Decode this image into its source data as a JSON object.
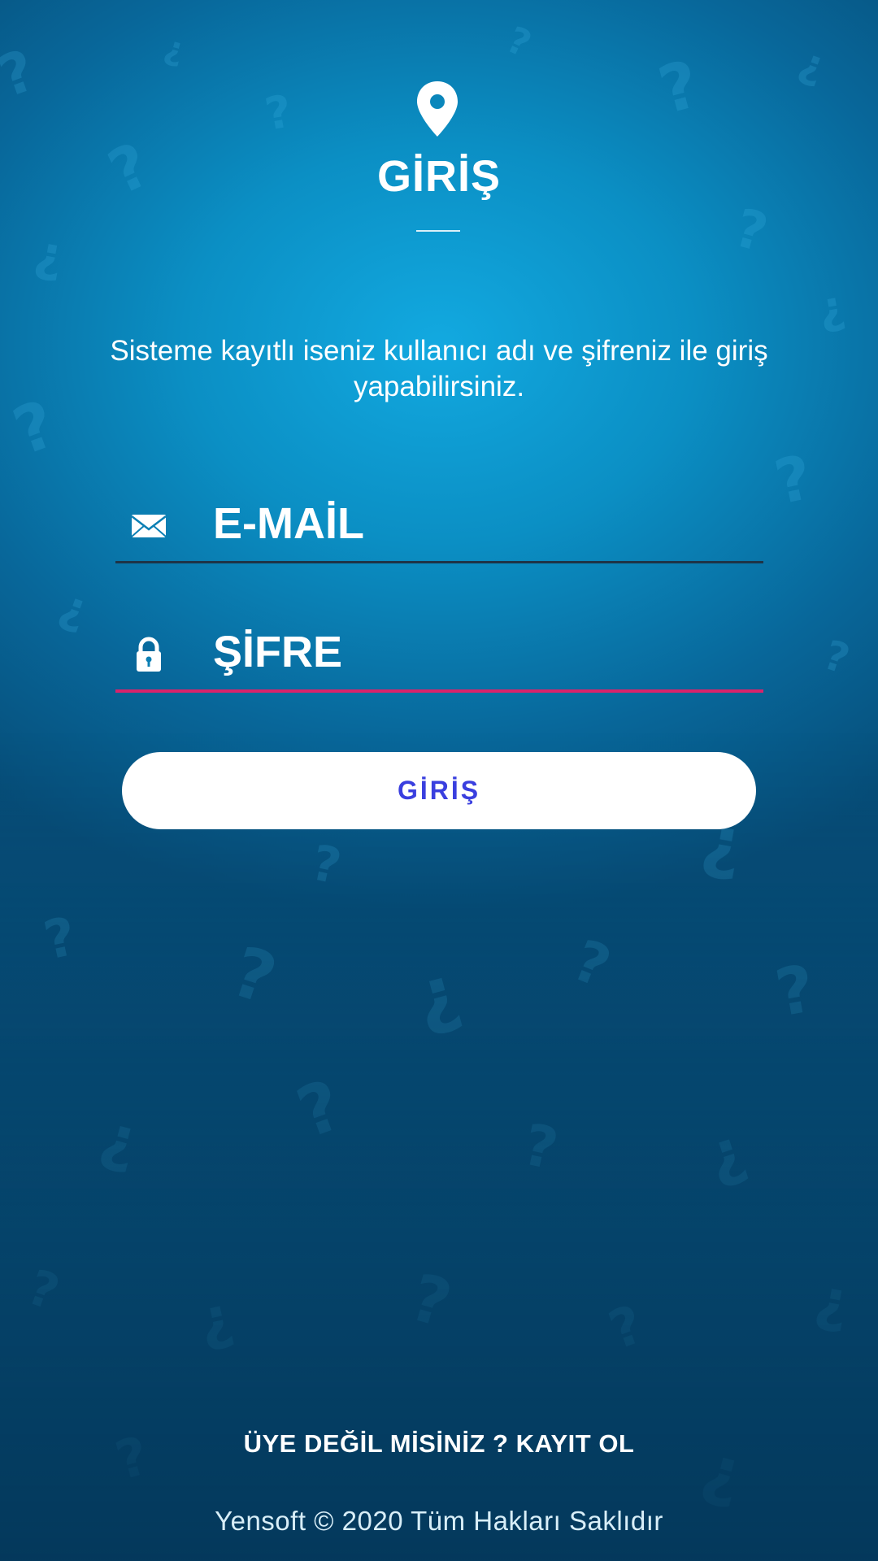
{
  "header": {
    "icon": "map-pin-icon",
    "title": "GİRİŞ",
    "subtitle": "Sisteme kayıtlı iseniz kullanıcı adı ve şifreniz ile giriş yapabilirsiniz."
  },
  "form": {
    "email": {
      "icon": "envelope-icon",
      "placeholder": "E-MAİL",
      "value": ""
    },
    "password": {
      "icon": "lock-icon",
      "placeholder": "ŞİFRE",
      "value": ""
    },
    "submit_label": "GİRİŞ"
  },
  "register_link": "ÜYE DEĞİL MİSİNİZ ? KAYIT OL",
  "footer": "Yensoft © 2020 Tüm Hakları Saklıdır",
  "colors": {
    "background": "#0b8fc4",
    "accent_underline": "#d9236b",
    "button_text": "#3a3fdf",
    "button_background": "#ffffff"
  }
}
